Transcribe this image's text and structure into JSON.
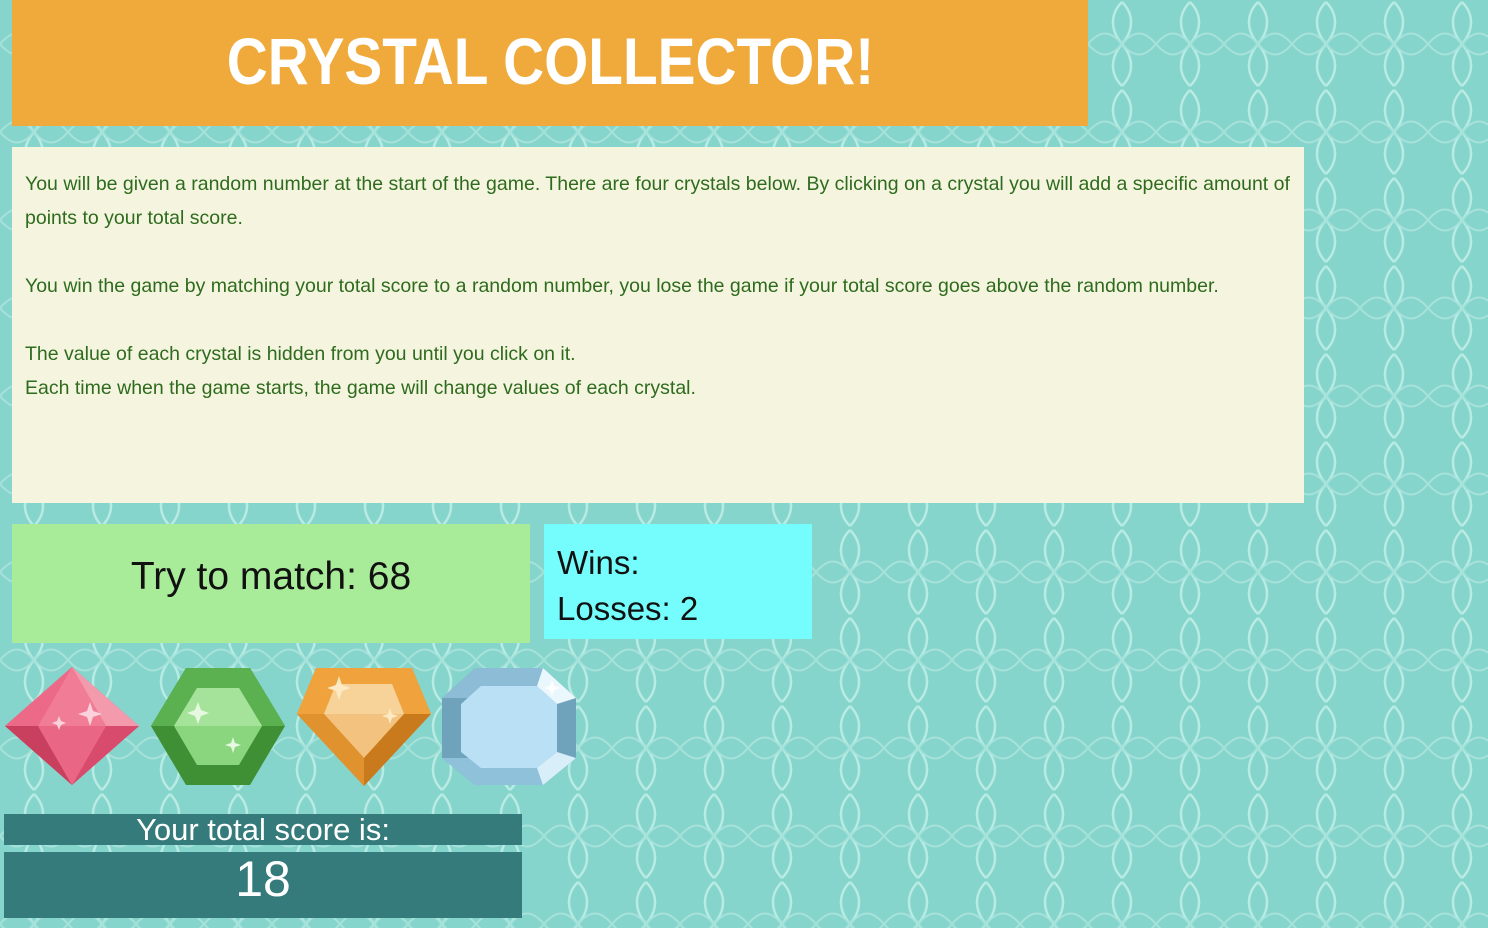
{
  "header": {
    "title": "CRYSTAL COLLECTOR!"
  },
  "instructions": {
    "paragraph_1": "You will be given a random number at the start of the game. There are four crystals below. By clicking on a crystal you will add a specific amount of points to your total score.",
    "paragraph_2": "You win the game by matching your total score to a random number, you lose the game if your total score goes above the random number.",
    "line_3": "The value of each crystal is hidden from you until you click on it.",
    "line_4": "Each time when the game starts, the game will change values of each crystal."
  },
  "target": {
    "label": "Try to match: 68"
  },
  "stats": {
    "wins_label": "Wins:",
    "losses_label": "Losses: 2"
  },
  "crystals": [
    {
      "name": "red-crystal-icon",
      "color": "#e8587a"
    },
    {
      "name": "green-crystal-icon",
      "color": "#5bb14f"
    },
    {
      "name": "orange-crystal-icon",
      "color": "#f0a33c"
    },
    {
      "name": "blue-crystal-icon",
      "color": "#a9d5ef"
    }
  ],
  "score": {
    "label": "Your total score is:",
    "value": "18"
  },
  "colors": {
    "background": "#86d5cc",
    "banner": "#f0aa3c",
    "instructions_bg": "#f5f5df",
    "instructions_text": "#2e6b1e",
    "target_bg": "#a8eb98",
    "stats_bg": "#75fcfc",
    "score_bg": "#367b7b"
  }
}
